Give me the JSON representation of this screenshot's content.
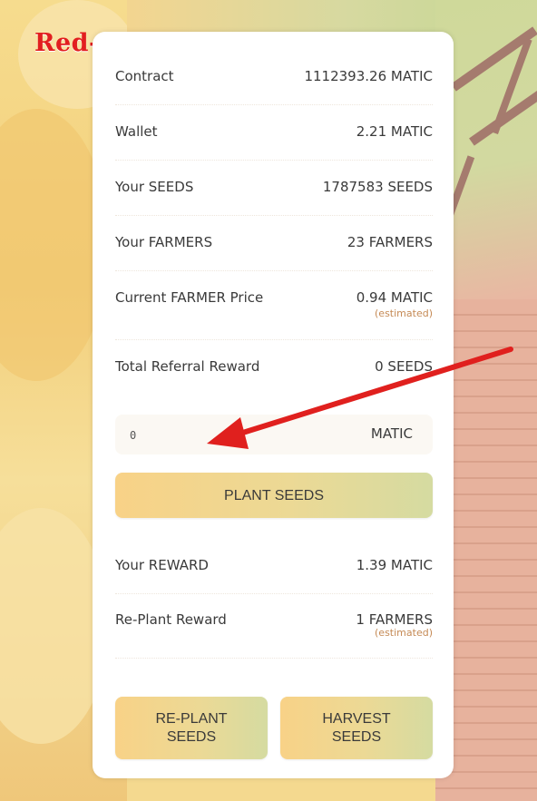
{
  "watermark": "Red-King",
  "stats": {
    "contract": {
      "label": "Contract",
      "value": "1112393.26 MATIC"
    },
    "wallet": {
      "label": "Wallet",
      "value": "2.21 MATIC"
    },
    "seeds": {
      "label": "Your SEEDS",
      "value": "1787583 SEEDS"
    },
    "farmers": {
      "label": "Your FARMERS",
      "value": "23 FARMERS"
    },
    "price": {
      "label": "Current FARMER Price",
      "value": "0.94 MATIC",
      "note": "(estimated)"
    },
    "referral": {
      "label": "Total Referral Reward",
      "value": "0 SEEDS"
    }
  },
  "amount_input": {
    "value": "0",
    "unit": "MATIC"
  },
  "plant_button": "PLANT SEEDS",
  "reward": {
    "label": "Your REWARD",
    "value": "1.39 MATIC"
  },
  "replant_reward": {
    "label": "Re-Plant Reward",
    "value": "1 FARMERS",
    "note": "(estimated)"
  },
  "replant_button": {
    "line1": "RE-PLANT",
    "line2": "SEEDS"
  },
  "harvest_button": {
    "line1": "HARVEST",
    "line2": "SEEDS"
  },
  "colors": {
    "arrow": "#e0201e",
    "button_start": "#f8d287",
    "button_end": "#d5dba1",
    "note": "#c58a55"
  }
}
